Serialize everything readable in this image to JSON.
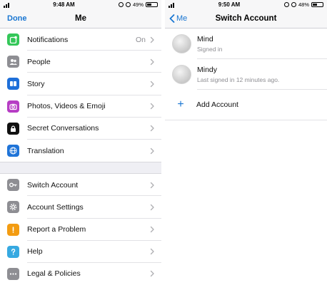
{
  "left": {
    "status": {
      "time": "9:48 AM",
      "battery": "49%",
      "battery_level": 0.49
    },
    "nav": {
      "left_action": "Done",
      "title": "Me"
    },
    "groups": [
      [
        {
          "label": "Notifications",
          "value": "On",
          "icon": "notification-icon",
          "color": "#34c759"
        },
        {
          "label": "People",
          "value": "",
          "icon": "people-icon",
          "color": "#8e8e93"
        },
        {
          "label": "Story",
          "value": "",
          "icon": "story-icon",
          "color": "#1e6fd9"
        },
        {
          "label": "Photos, Videos & Emoji",
          "value": "",
          "icon": "camera-icon",
          "color": "#b63cc4"
        },
        {
          "label": "Secret Conversations",
          "value": "",
          "icon": "lock-icon",
          "color": "#111111"
        },
        {
          "label": "Translation",
          "value": "",
          "icon": "globe-icon",
          "color": "#1f74d8"
        }
      ],
      [
        {
          "label": "Switch Account",
          "value": "",
          "icon": "key-icon",
          "color": "#8e8e93"
        },
        {
          "label": "Account Settings",
          "value": "",
          "icon": "gear-icon",
          "color": "#8e8e93"
        },
        {
          "label": "Report a Problem",
          "value": "",
          "icon": "warning-icon",
          "color": "#f39c12"
        },
        {
          "label": "Help",
          "value": "",
          "icon": "help-icon",
          "color": "#36a9e1"
        },
        {
          "label": "Legal & Policies",
          "value": "",
          "icon": "more-icon",
          "color": "#8e8e93"
        }
      ]
    ]
  },
  "right": {
    "status": {
      "time": "9:50 AM",
      "battery": "48%",
      "battery_level": 0.48
    },
    "nav": {
      "back_label": "Me",
      "title": "Switch Account"
    },
    "accounts": [
      {
        "name": "Mind",
        "subtitle": "Signed in"
      },
      {
        "name": "Mindy",
        "subtitle": "Last signed in 12 minutes ago."
      }
    ],
    "add_account_label": "Add Account",
    "add_icon": "plus-icon",
    "accent": "#1976d2"
  }
}
